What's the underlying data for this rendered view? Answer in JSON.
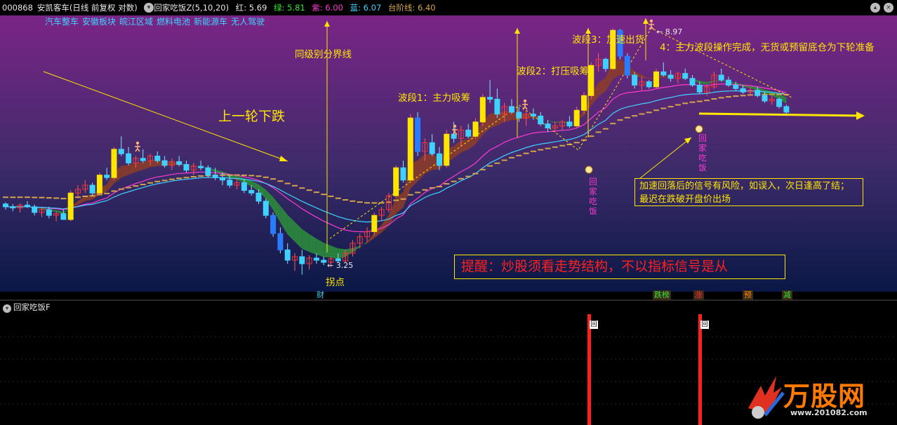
{
  "header": {
    "code": "000868",
    "name": "安凯客车",
    "mode": "(日线 前复权 对数)",
    "indicator": "回家吃饭Z(5,10,20)",
    "red_label": "红: 5.69",
    "green_label": "绿: 5.81",
    "purple_label": "紫: 6.00",
    "blue_label": "蓝: 6.07",
    "step_label": "台阶线: 6.40",
    "colors": {
      "red": "#ff3030",
      "green": "#35e835",
      "purple": "#ff3ad2",
      "blue": "#3fd1ff",
      "step": "#d4a34a"
    }
  },
  "sectors": [
    "汽车整车",
    "安徽板块",
    "皖江区域",
    "燃料电池",
    "新能源车",
    "无人驾驶"
  ],
  "annotations": {
    "prev_decline": "上一轮下跌",
    "boundary": "同级别分界线",
    "wave1": "波段1：主力吸筹",
    "wave2": "波段2：打压吸筹",
    "wave3": "波段3：加速出货",
    "wave4": "4：主力波段操作完成，无货或预留底仓为下轮准备",
    "turn_point": "拐点",
    "signal_vertical": "回家吃饭",
    "risk_note_1": "加速回落后的信号有风险，如误入，次日逢高了结；",
    "risk_note_2": "最迟在跌破开盘价出场",
    "reminder": "提醒：炒股须看走势结构，不以指标信号是从"
  },
  "price_labels": {
    "low": "← 3.25",
    "high": "← 8.97"
  },
  "events": [
    {
      "label": "财",
      "color": "#3fd1ff"
    },
    {
      "label": "跌榜",
      "color": "#35e835"
    },
    {
      "label": "涨",
      "color": "#ff3030"
    },
    {
      "label": "预",
      "color": "#ff8c00"
    },
    {
      "label": "减",
      "color": "#35e835"
    }
  ],
  "lower_panel": {
    "title": "回家吃饭F",
    "signal_label": "回"
  },
  "watermark": {
    "text": "万股网",
    "url": "www.201082.com"
  },
  "chart_data": {
    "type": "candlestick",
    "scale": "log",
    "ylim": [
      3.1,
      9.3
    ],
    "candles": [
      [
        4.35,
        4.38,
        4.25,
        4.3
      ],
      [
        4.3,
        4.35,
        4.22,
        4.28
      ],
      [
        4.28,
        4.36,
        4.2,
        4.33
      ],
      [
        4.33,
        4.4,
        4.28,
        4.3
      ],
      [
        4.3,
        4.34,
        4.15,
        4.2
      ],
      [
        4.2,
        4.28,
        4.12,
        4.25
      ],
      [
        4.25,
        4.3,
        4.1,
        4.15
      ],
      [
        4.15,
        4.22,
        4.05,
        4.18
      ],
      [
        4.18,
        4.25,
        4.1,
        4.08
      ],
      [
        4.08,
        4.6,
        4.05,
        4.55
      ],
      [
        4.55,
        4.7,
        4.45,
        4.62
      ],
      [
        4.62,
        4.8,
        4.55,
        4.7
      ],
      [
        4.7,
        4.75,
        4.5,
        4.55
      ],
      [
        4.55,
        4.95,
        4.5,
        4.9
      ],
      [
        4.9,
        5.05,
        4.8,
        4.85
      ],
      [
        4.85,
        5.5,
        4.8,
        5.45
      ],
      [
        5.45,
        5.75,
        5.3,
        5.35
      ],
      [
        5.35,
        5.5,
        5.1,
        5.15
      ],
      [
        5.15,
        5.3,
        5.05,
        5.25
      ],
      [
        5.25,
        5.45,
        5.15,
        5.2
      ],
      [
        5.2,
        5.35,
        5.1,
        5.3
      ],
      [
        5.3,
        5.4,
        5.15,
        5.2
      ],
      [
        5.2,
        5.3,
        5.05,
        5.1
      ],
      [
        5.1,
        5.25,
        5.0,
        5.18
      ],
      [
        5.18,
        5.3,
        5.08,
        5.12
      ],
      [
        5.12,
        5.2,
        4.95,
        5.0
      ],
      [
        5.0,
        5.15,
        4.9,
        5.08
      ],
      [
        5.08,
        5.2,
        5.0,
        5.05
      ],
      [
        5.05,
        5.1,
        4.85,
        4.9
      ],
      [
        4.9,
        5.05,
        4.8,
        4.85
      ],
      [
        4.85,
        4.95,
        4.7,
        4.8
      ],
      [
        4.8,
        4.9,
        4.65,
        4.7
      ],
      [
        4.7,
        4.85,
        4.62,
        4.75
      ],
      [
        4.75,
        4.82,
        4.55,
        4.6
      ],
      [
        4.6,
        4.7,
        4.5,
        4.55
      ],
      [
        4.55,
        4.62,
        4.35,
        4.4
      ],
      [
        4.4,
        4.45,
        4.1,
        4.15
      ],
      [
        4.15,
        4.2,
        3.8,
        3.85
      ],
      [
        3.85,
        3.95,
        3.55,
        3.6
      ],
      [
        3.6,
        3.7,
        3.4,
        3.45
      ],
      [
        3.45,
        3.55,
        3.3,
        3.5
      ],
      [
        3.5,
        3.6,
        3.25,
        3.4
      ],
      [
        3.4,
        3.52,
        3.32,
        3.48
      ],
      [
        3.48,
        3.55,
        3.4,
        3.45
      ],
      [
        3.45,
        3.5,
        3.38,
        3.42
      ],
      [
        3.42,
        3.5,
        3.35,
        3.47
      ],
      [
        3.47,
        3.55,
        3.42,
        3.44
      ],
      [
        3.44,
        3.6,
        3.42,
        3.55
      ],
      [
        3.55,
        3.75,
        3.5,
        3.7
      ],
      [
        3.7,
        3.85,
        3.62,
        3.8
      ],
      [
        3.8,
        3.95,
        3.72,
        3.88
      ],
      [
        3.88,
        4.2,
        3.82,
        4.15
      ],
      [
        4.15,
        4.3,
        4.05,
        4.25
      ],
      [
        4.25,
        4.55,
        4.2,
        4.5
      ],
      [
        4.5,
        5.1,
        4.45,
        5.05
      ],
      [
        5.05,
        5.2,
        4.75,
        4.8
      ],
      [
        4.8,
        6.3,
        4.75,
        6.2
      ],
      [
        6.2,
        6.35,
        5.3,
        5.4
      ],
      [
        5.4,
        5.7,
        5.2,
        5.6
      ],
      [
        5.6,
        5.8,
        5.3,
        5.35
      ],
      [
        5.35,
        5.5,
        5.0,
        5.1
      ],
      [
        5.1,
        5.9,
        5.05,
        5.8
      ],
      [
        5.8,
        6.1,
        5.6,
        5.7
      ],
      [
        5.7,
        6.0,
        5.5,
        5.9
      ],
      [
        5.9,
        6.05,
        5.7,
        5.75
      ],
      [
        5.75,
        6.2,
        5.7,
        6.1
      ],
      [
        6.1,
        6.85,
        6.0,
        6.75
      ],
      [
        6.75,
        7.25,
        6.6,
        6.7
      ],
      [
        6.7,
        7.0,
        6.2,
        6.3
      ],
      [
        6.3,
        6.6,
        6.1,
        6.5
      ],
      [
        6.5,
        6.7,
        6.3,
        6.35
      ],
      [
        6.35,
        6.5,
        6.1,
        6.2
      ],
      [
        6.2,
        6.4,
        6.0,
        6.3
      ],
      [
        6.3,
        6.45,
        6.15,
        6.25
      ],
      [
        6.25,
        6.35,
        6.0,
        6.05
      ],
      [
        6.05,
        6.15,
        5.85,
        5.95
      ],
      [
        5.95,
        6.1,
        5.85,
        6.0
      ],
      [
        6.0,
        6.15,
        5.9,
        6.1
      ],
      [
        6.1,
        6.25,
        5.95,
        6.0
      ],
      [
        6.0,
        6.5,
        5.95,
        6.4
      ],
      [
        6.4,
        6.9,
        6.3,
        6.8
      ],
      [
        6.8,
        7.8,
        6.7,
        7.7
      ],
      [
        7.7,
        8.1,
        7.5,
        7.9
      ],
      [
        7.9,
        7.95,
        7.5,
        7.6
      ],
      [
        7.6,
        8.97,
        7.55,
        8.9
      ],
      [
        8.9,
        8.95,
        7.9,
        8.0
      ],
      [
        8.0,
        8.1,
        7.3,
        7.4
      ],
      [
        7.4,
        7.5,
        7.0,
        7.1
      ],
      [
        7.1,
        7.35,
        6.95,
        7.2
      ],
      [
        7.2,
        7.25,
        7.0,
        7.05
      ],
      [
        7.05,
        7.6,
        7.0,
        7.5
      ],
      [
        7.5,
        7.8,
        7.35,
        7.4
      ],
      [
        7.4,
        7.55,
        7.2,
        7.3
      ],
      [
        7.3,
        7.5,
        7.15,
        7.45
      ],
      [
        7.45,
        7.6,
        7.25,
        7.3
      ],
      [
        7.3,
        7.4,
        7.05,
        7.1
      ],
      [
        7.1,
        7.2,
        6.85,
        6.9
      ],
      [
        6.9,
        7.1,
        6.8,
        7.05
      ],
      [
        7.05,
        7.5,
        7.0,
        7.4
      ],
      [
        7.4,
        7.6,
        7.2,
        7.25
      ],
      [
        7.25,
        7.35,
        7.05,
        7.1
      ],
      [
        7.1,
        7.2,
        6.95,
        7.0
      ],
      [
        7.0,
        7.1,
        6.85,
        6.9
      ],
      [
        6.9,
        7.05,
        6.8,
        6.95
      ],
      [
        6.95,
        7.05,
        6.75,
        6.8
      ],
      [
        6.8,
        6.9,
        6.6,
        6.65
      ],
      [
        6.65,
        6.8,
        6.55,
        6.7
      ],
      [
        6.7,
        6.75,
        6.45,
        6.5
      ],
      [
        6.5,
        6.55,
        6.3,
        6.35
      ]
    ]
  }
}
